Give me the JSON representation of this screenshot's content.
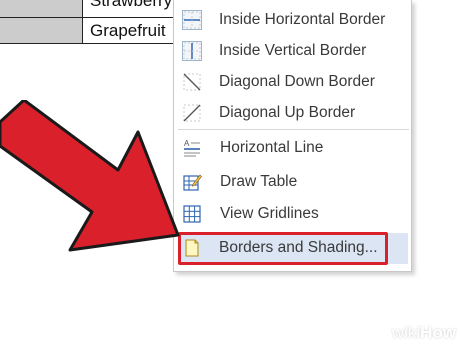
{
  "table": {
    "rows": [
      {
        "fruit": "Strawberry"
      },
      {
        "fruit": "Grapefruit"
      }
    ]
  },
  "menu": {
    "items": [
      {
        "label": "Inside Horizontal Border",
        "icon": "inside-horizontal-border-icon"
      },
      {
        "label": "Inside Vertical Border",
        "icon": "inside-vertical-border-icon"
      },
      {
        "label": "Diagonal Down Border",
        "icon": "diagonal-down-border-icon"
      },
      {
        "label": "Diagonal Up Border",
        "icon": "diagonal-up-border-icon"
      },
      {
        "label": "Horizontal Line",
        "icon": "horizontal-line-icon"
      },
      {
        "label": "Draw Table",
        "icon": "draw-table-icon"
      },
      {
        "label": "View Gridlines",
        "icon": "view-gridlines-icon"
      },
      {
        "label": "Borders and Shading...",
        "icon": "borders-shading-icon",
        "selected": true
      }
    ]
  },
  "colors": {
    "arrow": "#d9202b",
    "highlight": "#dbe5f3",
    "outline": "#d9202b"
  },
  "watermark": {
    "brand_a": "wiki",
    "brand_b": "How"
  }
}
